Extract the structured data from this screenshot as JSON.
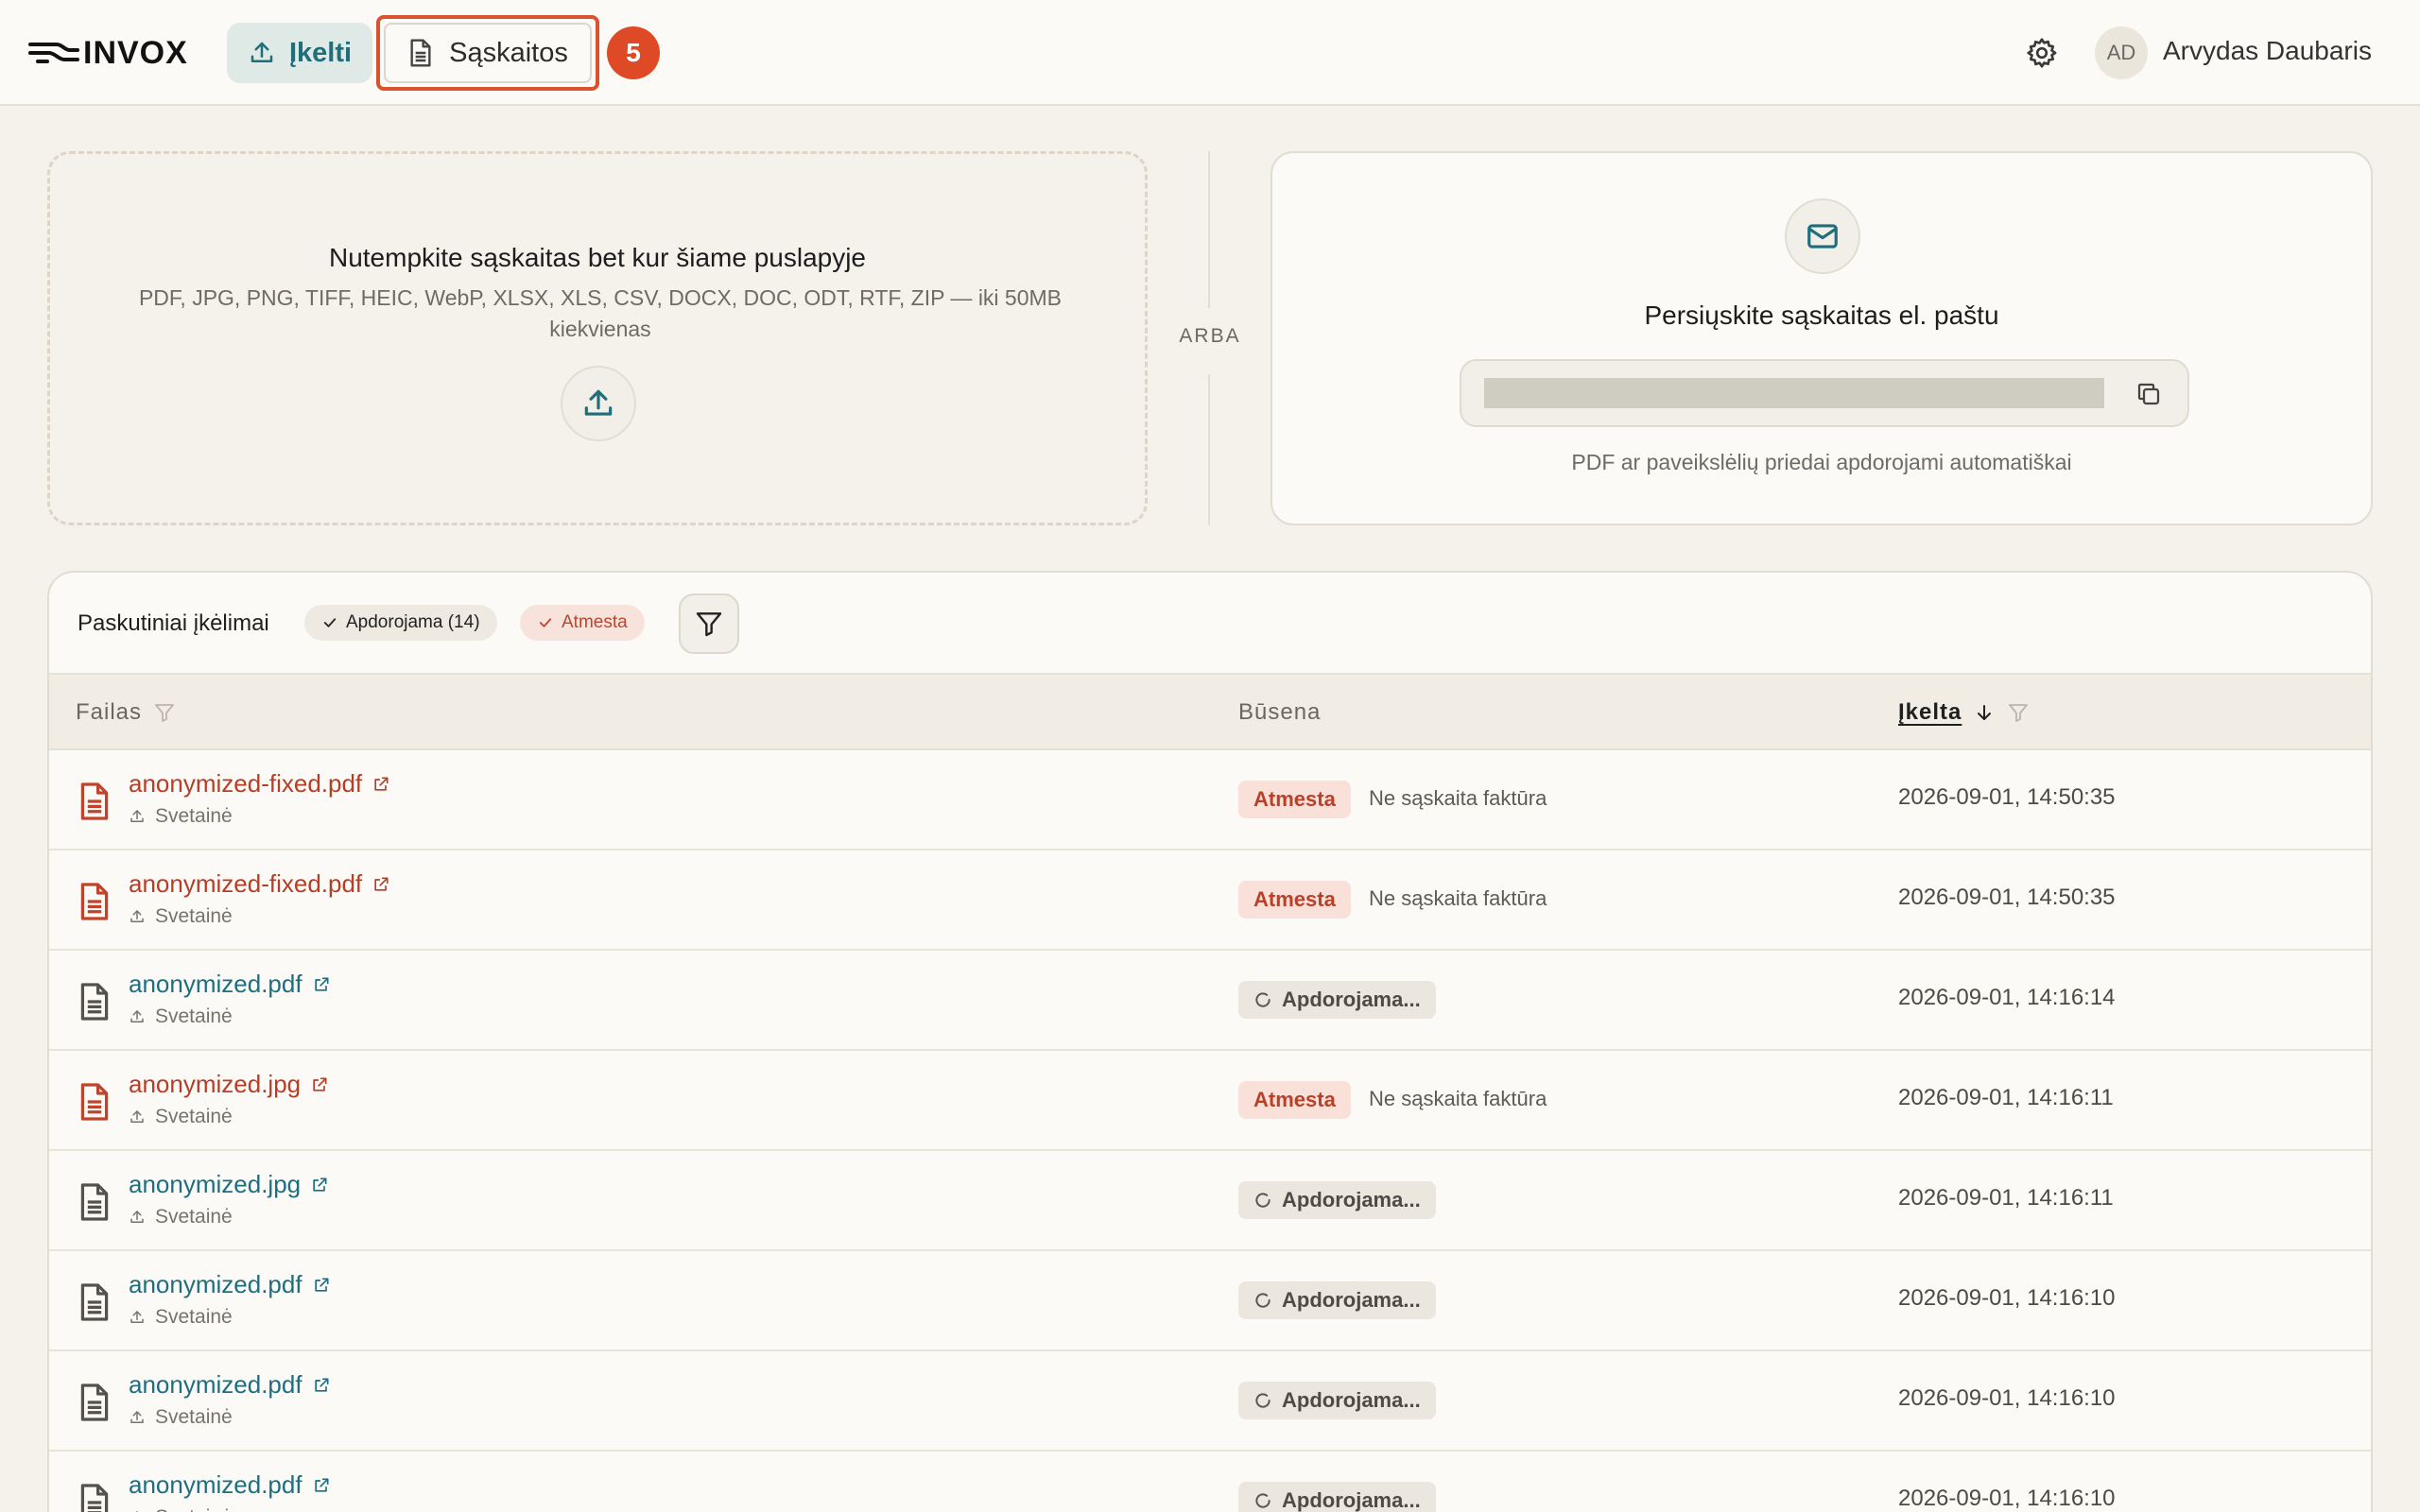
{
  "header": {
    "logo_text": "INVOX",
    "upload_label": "Įkelti",
    "invoices_label": "Sąskaitos",
    "invoices_count": "5",
    "user_initials": "AD",
    "user_name": "Arvydas Daubaris"
  },
  "upload": {
    "drop_title": "Nutempkite sąskaitas bet kur šiame puslapyje",
    "drop_formats": "PDF, JPG, PNG, TIFF, HEIC, WebP, XLSX, XLS, CSV, DOCX, DOC, ODT, RTF, ZIP — iki 50MB kiekvienas",
    "or_label": "ARBA",
    "email_title": "Persiųskite sąskaitas el. paštu",
    "email_note": "PDF ar paveikslėlių priedai apdorojami automatiškai"
  },
  "recent": {
    "title": "Paskutiniai įkėlimai",
    "chip_processing": "Apdorojama (14)",
    "chip_rejected": "Atmesta"
  },
  "table": {
    "col_file": "Failas",
    "col_status": "Būsena",
    "col_uploaded": "Įkelta",
    "rows": [
      {
        "name": "anonymized-fixed.pdf",
        "source": "Svetainė",
        "status": "Atmesta",
        "reason": "Ne sąskaita faktūra",
        "uploaded": "2026-09-01, 14:50:35",
        "state": "rejected"
      },
      {
        "name": "anonymized-fixed.pdf",
        "source": "Svetainė",
        "status": "Atmesta",
        "reason": "Ne sąskaita faktūra",
        "uploaded": "2026-09-01, 14:50:35",
        "state": "rejected"
      },
      {
        "name": "anonymized.pdf",
        "source": "Svetainė",
        "status": "Apdorojama...",
        "reason": "",
        "uploaded": "2026-09-01, 14:16:14",
        "state": "processing"
      },
      {
        "name": "anonymized.jpg",
        "source": "Svetainė",
        "status": "Atmesta",
        "reason": "Ne sąskaita faktūra",
        "uploaded": "2026-09-01, 14:16:11",
        "state": "rejected"
      },
      {
        "name": "anonymized.jpg",
        "source": "Svetainė",
        "status": "Apdorojama...",
        "reason": "",
        "uploaded": "2026-09-01, 14:16:11",
        "state": "processing"
      },
      {
        "name": "anonymized.pdf",
        "source": "Svetainė",
        "status": "Apdorojama...",
        "reason": "",
        "uploaded": "2026-09-01, 14:16:10",
        "state": "processing"
      },
      {
        "name": "anonymized.pdf",
        "source": "Svetainė",
        "status": "Apdorojama...",
        "reason": "",
        "uploaded": "2026-09-01, 14:16:10",
        "state": "processing"
      },
      {
        "name": "anonymized.pdf",
        "source": "Svetainė",
        "status": "Apdorojama...",
        "reason": "",
        "uploaded": "2026-09-01, 14:16:10",
        "state": "processing"
      }
    ]
  },
  "colors": {
    "accent": "#1f6e7c",
    "danger": "#df4a26",
    "background": "#f5f2ec"
  }
}
